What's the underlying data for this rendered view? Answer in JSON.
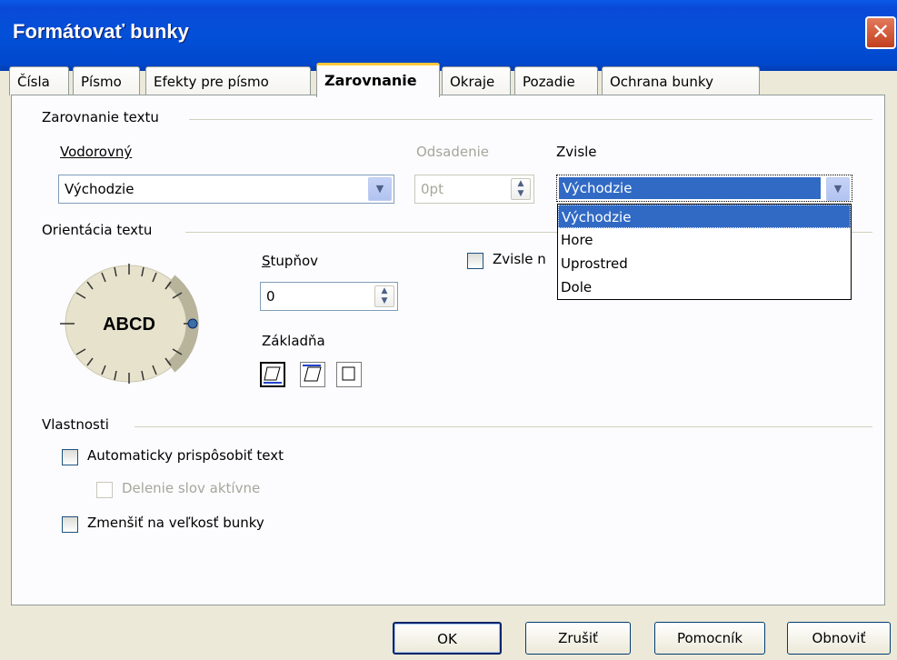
{
  "window": {
    "title": "Formátovať bunky",
    "close": "✕"
  },
  "tabs": [
    {
      "label": "Čísla"
    },
    {
      "label": "Písmo"
    },
    {
      "label": "Efekty pre písmo"
    },
    {
      "label": "Zarovnanie"
    },
    {
      "label": "Okraje"
    },
    {
      "label": "Pozadie"
    },
    {
      "label": "Ochrana bunky"
    }
  ],
  "text_alignment": {
    "group": "Zarovnanie textu",
    "horizontal_label": "Vodorovný",
    "horizontal_value": "Východzie",
    "indent_label": "Odsadenie",
    "indent_value": "0pt",
    "vertical_label": "Zvisle",
    "vertical_value": "Východzie",
    "vertical_options": [
      "Východzie",
      "Hore",
      "Uprostred",
      "Dole"
    ]
  },
  "orientation": {
    "group": "Orientácia textu",
    "dial_text": "ABCD",
    "degrees_label": "Stupňov",
    "degrees_value": "0",
    "baseline_label": "Základňa",
    "vertical_stacked_label": "Zvisle n"
  },
  "properties": {
    "group": "Vlastnosti",
    "auto_wrap": "Automaticky prispôsobiť text",
    "hyphenation": "Delenie slov aktívne",
    "shrink": "Zmenšiť na veľkosť bunky"
  },
  "buttons": {
    "ok": "OK",
    "cancel": "Zrušiť",
    "help": "Pomocník",
    "reset": "Obnoviť"
  },
  "colors": {
    "titlebar": "#0a4ad8",
    "selection": "#316ac5",
    "dialog": "#ece9d8"
  }
}
